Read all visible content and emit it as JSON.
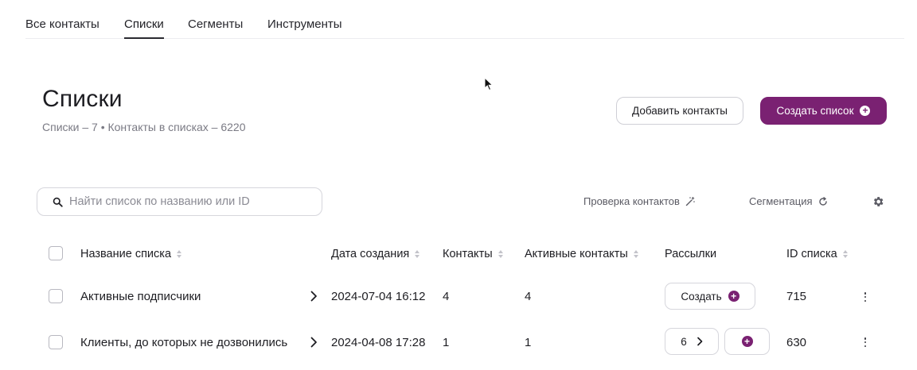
{
  "tabs": [
    {
      "label": "Все контакты",
      "active": false
    },
    {
      "label": "Списки",
      "active": true
    },
    {
      "label": "Сегменты",
      "active": false
    },
    {
      "label": "Инструменты",
      "active": false
    }
  ],
  "header": {
    "title": "Списки",
    "subtitle": "Списки – 7 • Контакты в списках – 6220",
    "add_contacts_label": "Добавить контакты",
    "create_list_label": "Создать список"
  },
  "search": {
    "placeholder": "Найти список по названию или ID",
    "value": ""
  },
  "tools": {
    "check_contacts_label": "Проверка контактов",
    "segmentation_label": "Сегментация",
    "settings_icon": "gear-icon"
  },
  "table": {
    "columns": {
      "name": "Название списка",
      "created": "Дата создания",
      "contacts": "Контакты",
      "active": "Активные контакты",
      "mailings": "Рассылки",
      "id": "ID списка"
    },
    "rows": [
      {
        "name": "Активные подписчики",
        "created": "2024-07-04 16:12",
        "contacts": "4",
        "active": "4",
        "mailing_label": "Создать",
        "id": "715"
      },
      {
        "name": "Клиенты, до которых не дозвонились",
        "created": "2024-04-08 17:28",
        "contacts": "1",
        "active": "1",
        "mailing_count": "6",
        "id": "630"
      }
    ]
  },
  "colors": {
    "accent": "#7a2172",
    "border": "#d6d6dc",
    "muted_text": "#7a7a84"
  }
}
